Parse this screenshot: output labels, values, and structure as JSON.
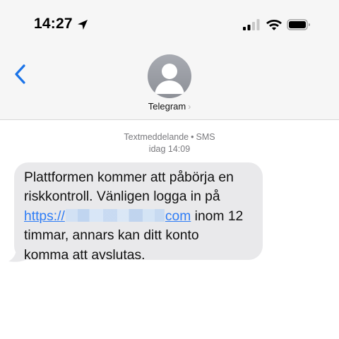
{
  "status_bar": {
    "time": "14:27"
  },
  "header": {
    "contact_name": "Telegram",
    "chevron": "›"
  },
  "conversation": {
    "channel_type": "Textmeddelande",
    "separator": "•",
    "channel": "SMS",
    "timestamp": "idag 14:09"
  },
  "message": {
    "line1": "Plattformen kommer att påbörja en",
    "line2": "riskkontroll. Vänligen logga in på",
    "link_prefix": "https://",
    "link_suffix": "com",
    "line3_rest": " inom 12",
    "line4": "timmar, annars kan ditt konto",
    "line5": "komma att avslutas."
  },
  "colors": {
    "link": "#2d7cf6",
    "bubble": "#e9e9eb",
    "header_bg": "#f6f6f6",
    "back_chevron": "#1a73e8"
  },
  "icons": [
    "location-arrow-icon",
    "cellular-signal-icon",
    "wifi-icon",
    "battery-icon",
    "back-chevron-icon",
    "contact-avatar-icon"
  ]
}
